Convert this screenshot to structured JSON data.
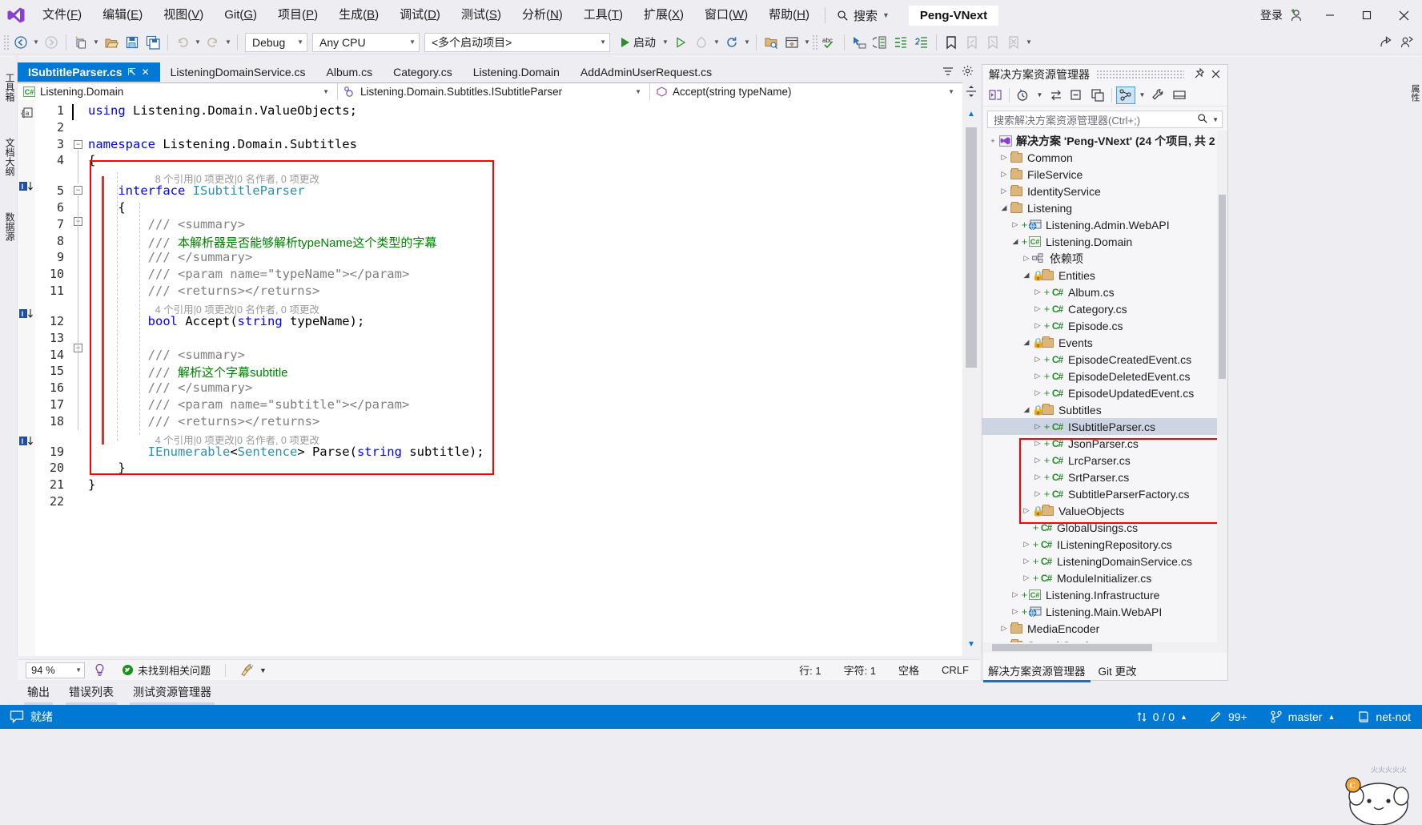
{
  "window": {
    "project_chip": "Peng-VNext",
    "signin_label": "登录",
    "minimize": "–",
    "maximize": "□",
    "close": "✕"
  },
  "menu": {
    "items": [
      {
        "label": "文件(F)"
      },
      {
        "label": "编辑(E)"
      },
      {
        "label": "视图(V)"
      },
      {
        "label": "Git(G)"
      },
      {
        "label": "项目(P)"
      },
      {
        "label": "生成(B)"
      },
      {
        "label": "调试(D)"
      },
      {
        "label": "测试(S)"
      },
      {
        "label": "分析(N)"
      },
      {
        "label": "工具(T)"
      },
      {
        "label": "扩展(X)"
      },
      {
        "label": "窗口(W)"
      },
      {
        "label": "帮助(H)"
      }
    ],
    "search_placeholder": "搜索"
  },
  "toolbar": {
    "configuration": "Debug",
    "platform": "Any CPU",
    "startup_project": "<多个启动项目>",
    "start_label": "启动"
  },
  "left_rail": {
    "tabs": [
      "工具箱",
      "文档大纲",
      "数据源"
    ]
  },
  "right_rail": {
    "tabs": [
      "属性"
    ]
  },
  "document_tabs": [
    {
      "label": "ISubtitleParser.cs",
      "active": true,
      "pin": "⇱",
      "close": "✕"
    },
    {
      "label": "ListeningDomainService.cs",
      "active": false
    },
    {
      "label": "Album.cs",
      "active": false
    },
    {
      "label": "Category.cs",
      "active": false
    },
    {
      "label": "Listening.Domain",
      "active": false
    },
    {
      "label": "AddAdminUserRequest.cs",
      "active": false
    }
  ],
  "nav_bar": {
    "project": "Listening.Domain",
    "type": "Listening.Domain.Subtitles.ISubtitleParser",
    "member": "Accept(string typeName)"
  },
  "editor": {
    "lines": [
      {
        "n": "1",
        "segments": [
          {
            "t": "using ",
            "c": "k"
          },
          {
            "t": "Listening.Domain.ValueObjects;",
            "c": "pl"
          }
        ]
      },
      {
        "n": "2",
        "segments": []
      },
      {
        "n": "3",
        "segments": [
          {
            "t": "namespace ",
            "c": "k"
          },
          {
            "t": "Listening.Domain.Subtitles",
            "c": "pl"
          }
        ]
      },
      {
        "n": "4",
        "segments": [
          {
            "t": "{",
            "c": "pl"
          }
        ]
      },
      {
        "n": "5",
        "segments": [
          {
            "t": "    interface ",
            "c": "k"
          },
          {
            "t": "ISubtitleParser",
            "c": "t"
          }
        ]
      },
      {
        "n": "6",
        "segments": [
          {
            "t": "    {",
            "c": "pl"
          }
        ]
      },
      {
        "n": "7",
        "segments": [
          {
            "t": "        /// <summary>",
            "c": "cmt"
          }
        ]
      },
      {
        "n": "8",
        "segments": [
          {
            "t": "        /// ",
            "c": "cmt"
          },
          {
            "t": "本解析器是否能够解析typeName这个类型的字幕",
            "c": "cmtg"
          }
        ]
      },
      {
        "n": "9",
        "segments": [
          {
            "t": "        /// </summary>",
            "c": "cmt"
          }
        ]
      },
      {
        "n": "10",
        "segments": [
          {
            "t": "        /// <param name=",
            "c": "cmt"
          },
          {
            "t": "\"typeName\"",
            "c": "cmts"
          },
          {
            "t": "></param>",
            "c": "cmt"
          }
        ]
      },
      {
        "n": "11",
        "segments": [
          {
            "t": "        /// <returns></returns>",
            "c": "cmt"
          }
        ]
      },
      {
        "n": "12",
        "segments": [
          {
            "t": "        bool ",
            "c": "k"
          },
          {
            "t": "Accept(",
            "c": "pl"
          },
          {
            "t": "string ",
            "c": "k"
          },
          {
            "t": "typeName);",
            "c": "pl"
          }
        ]
      },
      {
        "n": "13",
        "segments": []
      },
      {
        "n": "14",
        "segments": [
          {
            "t": "        /// <summary>",
            "c": "cmt"
          }
        ]
      },
      {
        "n": "15",
        "segments": [
          {
            "t": "        /// ",
            "c": "cmt"
          },
          {
            "t": "解析这个字幕subtitle",
            "c": "cmtg"
          }
        ]
      },
      {
        "n": "16",
        "segments": [
          {
            "t": "        /// </summary>",
            "c": "cmt"
          }
        ]
      },
      {
        "n": "17",
        "segments": [
          {
            "t": "        /// <param name=",
            "c": "cmt"
          },
          {
            "t": "\"subtitle\"",
            "c": "cmts"
          },
          {
            "t": "></param>",
            "c": "cmt"
          }
        ]
      },
      {
        "n": "18",
        "segments": [
          {
            "t": "        /// <returns></returns>",
            "c": "cmt"
          }
        ]
      },
      {
        "n": "19",
        "segments": [
          {
            "t": "        IEnumerable",
            "c": "t"
          },
          {
            "t": "<",
            "c": "pl"
          },
          {
            "t": "Sentence",
            "c": "t"
          },
          {
            "t": "> Parse(",
            "c": "pl"
          },
          {
            "t": "string ",
            "c": "k"
          },
          {
            "t": "subtitle);",
            "c": "pl"
          }
        ]
      },
      {
        "n": "20",
        "segments": [
          {
            "t": "    }",
            "c": "pl"
          }
        ]
      },
      {
        "n": "21",
        "segments": [
          {
            "t": "}",
            "c": "pl"
          }
        ]
      },
      {
        "n": "22",
        "segments": []
      }
    ],
    "codelens": [
      {
        "line": 5,
        "text": "8 个引用|0 项更改|0 名作者, 0 项更改"
      },
      {
        "line": 12,
        "text": "4 个引用|0 项更改|0 名作者, 0 项更改"
      },
      {
        "line": 19,
        "text": "4 个引用|0 项更改|0 名作者, 0 项更改"
      }
    ]
  },
  "editor_status": {
    "zoom": "94 %",
    "problems": "未找到相关问题",
    "line": "行: 1",
    "column": "字符: 1",
    "spaces": "空格",
    "eol": "CRLF"
  },
  "bottom_tool_tabs": [
    "输出",
    "错误列表",
    "测试资源管理器"
  ],
  "status_bar": {
    "ready": "就绪",
    "task_count": "0 / 0",
    "issues": "99+",
    "branch": "master",
    "repo": "net-not"
  },
  "solution_explorer": {
    "title": "解决方案资源管理器",
    "search_placeholder": "搜索解决方案资源管理器(Ctrl+;)",
    "bottom_tabs": [
      {
        "label": "解决方案资源管理器",
        "active": true
      },
      {
        "label": "Git 更改",
        "active": false
      }
    ],
    "tree": [
      {
        "indent": 0,
        "tw": "+",
        "icon": "solution",
        "label": "解决方案 'Peng-VNext' (24 个项目, 共 2",
        "bold": true
      },
      {
        "indent": 1,
        "tw": "▷",
        "icon": "folder",
        "label": "Common"
      },
      {
        "indent": 1,
        "tw": "▷",
        "icon": "folder",
        "label": "FileService"
      },
      {
        "indent": 1,
        "tw": "▷",
        "icon": "folder",
        "label": "IdentityService"
      },
      {
        "indent": 1,
        "tw": "◢",
        "icon": "folder",
        "label": "Listening"
      },
      {
        "indent": 2,
        "tw": "▷",
        "plus": "+",
        "icon": "web",
        "label": "Listening.Admin.WebAPI"
      },
      {
        "indent": 2,
        "tw": "◢",
        "plus": "+",
        "icon": "cs-proj",
        "label": "Listening.Domain"
      },
      {
        "indent": 3,
        "tw": "▷",
        "icon": "deps",
        "label": "依赖项"
      },
      {
        "indent": 3,
        "tw": "◢",
        "lock": true,
        "icon": "folder",
        "label": "Entities"
      },
      {
        "indent": 4,
        "tw": "▷",
        "plus": "+",
        "icon": "cs",
        "label": "Album.cs"
      },
      {
        "indent": 4,
        "tw": "▷",
        "plus": "+",
        "icon": "cs",
        "label": "Category.cs"
      },
      {
        "indent": 4,
        "tw": "▷",
        "plus": "+",
        "icon": "cs",
        "label": "Episode.cs"
      },
      {
        "indent": 3,
        "tw": "◢",
        "lock": true,
        "icon": "folder",
        "label": "Events"
      },
      {
        "indent": 4,
        "tw": "▷",
        "plus": "+",
        "icon": "cs",
        "label": "EpisodeCreatedEvent.cs"
      },
      {
        "indent": 4,
        "tw": "▷",
        "plus": "+",
        "icon": "cs",
        "label": "EpisodeDeletedEvent.cs"
      },
      {
        "indent": 4,
        "tw": "▷",
        "plus": "+",
        "icon": "cs",
        "label": "EpisodeUpdatedEvent.cs"
      },
      {
        "indent": 3,
        "tw": "◢",
        "lock": true,
        "icon": "folder",
        "label": "Subtitles"
      },
      {
        "indent": 4,
        "tw": "▷",
        "plus": "+",
        "icon": "cs",
        "label": "ISubtitleParser.cs",
        "selected": true
      },
      {
        "indent": 4,
        "tw": "▷",
        "plus": "+",
        "icon": "cs",
        "label": "JsonParser.cs"
      },
      {
        "indent": 4,
        "tw": "▷",
        "plus": "+",
        "icon": "cs",
        "label": "LrcParser.cs"
      },
      {
        "indent": 4,
        "tw": "▷",
        "plus": "+",
        "icon": "cs",
        "label": "SrtParser.cs"
      },
      {
        "indent": 4,
        "tw": "▷",
        "plus": "+",
        "icon": "cs",
        "label": "SubtitleParserFactory.cs"
      },
      {
        "indent": 3,
        "tw": "▷",
        "lock": true,
        "icon": "folder",
        "label": "ValueObjects"
      },
      {
        "indent": 3,
        "tw": "",
        "plus": "+",
        "icon": "cs",
        "label": "GlobalUsings.cs"
      },
      {
        "indent": 3,
        "tw": "▷",
        "plus": "+",
        "icon": "cs",
        "label": "IListeningRepository.cs"
      },
      {
        "indent": 3,
        "tw": "▷",
        "plus": "+",
        "icon": "cs",
        "label": "ListeningDomainService.cs"
      },
      {
        "indent": 3,
        "tw": "▷",
        "plus": "+",
        "icon": "cs",
        "label": "ModuleInitializer.cs"
      },
      {
        "indent": 2,
        "tw": "▷",
        "plus": "+",
        "icon": "cs-proj",
        "label": "Listening.Infrastructure"
      },
      {
        "indent": 2,
        "tw": "▷",
        "plus": "+",
        "icon": "web",
        "label": "Listening.Main.WebAPI"
      },
      {
        "indent": 1,
        "tw": "▷",
        "icon": "folder",
        "label": "MediaEncoder"
      },
      {
        "indent": 1,
        "tw": "▷",
        "icon": "folder",
        "label": "SearchService"
      }
    ]
  }
}
